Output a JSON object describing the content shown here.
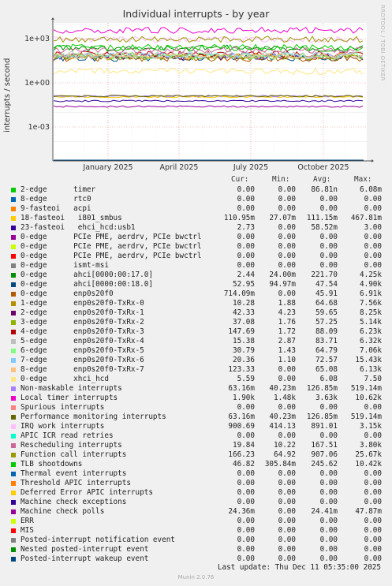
{
  "title": "Individual interrupts - by year",
  "side_text": "RRDTOOL / TOBI OETIKER",
  "ylabel": "interrupts / second",
  "footer": {
    "last_update": "Last update: Thu Dec 11 05:35:00 2025",
    "munin": "Munin 2.0.76"
  },
  "legend_headers": [
    "Cur:",
    "Min:",
    "Avg:",
    "Max:"
  ],
  "chart_data": {
    "type": "line",
    "title": "Individual interrupts - by year",
    "ylabel": "interrupts / second",
    "xlabel": "",
    "y_scale": "log",
    "y_ticks": [
      "1e+03",
      "1e+00",
      "1e-03"
    ],
    "x_ticks": [
      "January 2025",
      "April 2025",
      "July 2025",
      "October 2025"
    ],
    "grid": true,
    "series": [
      {
        "name": "2-edge timer",
        "color": "#00cc00",
        "cur": "0.00",
        "min": "0.00",
        "avg": "86.81n",
        "max": "6.08m"
      },
      {
        "name": "8-edge rtc0",
        "color": "#0066b3",
        "cur": "0.00",
        "min": "0.00",
        "avg": "0.00",
        "max": "0.00"
      },
      {
        "name": "9-fasteoi acpi",
        "color": "#ff8000",
        "cur": "0.00",
        "min": "0.00",
        "avg": "0.00",
        "max": "0.00"
      },
      {
        "name": "18-fasteoi i801_smbus",
        "color": "#ffcc00",
        "cur": "110.95m",
        "min": "27.07m",
        "avg": "111.15m",
        "max": "467.81m"
      },
      {
        "name": "23-fasteoi ehci_hcd:usb1",
        "color": "#330099",
        "cur": "2.73",
        "min": "0.00",
        "avg": "58.52m",
        "max": "3.00"
      },
      {
        "name": "0-edge PCIe PME, aerdrv, PCIe bwctrl",
        "color": "#990099",
        "cur": "0.00",
        "min": "0.00",
        "avg": "0.00",
        "max": "0.00"
      },
      {
        "name": "0-edge PCIe PME, aerdrv, PCIe bwctrl",
        "color": "#ccff00",
        "cur": "0.00",
        "min": "0.00",
        "avg": "0.00",
        "max": "0.00"
      },
      {
        "name": "0-edge PCIe PME, aerdrv, PCIe bwctrl",
        "color": "#ff0000",
        "cur": "0.00",
        "min": "0.00",
        "avg": "0.00",
        "max": "0.00"
      },
      {
        "name": "0-edge ismt-msi",
        "color": "#808080",
        "cur": "0.00",
        "min": "0.00",
        "avg": "0.00",
        "max": "0.00"
      },
      {
        "name": "0-edge ahci[0000:00:17.0]",
        "color": "#008f00",
        "cur": "2.44",
        "min": "24.00m",
        "avg": "221.70",
        "max": "4.25k"
      },
      {
        "name": "0-edge ahci[0000:00:18.0]",
        "color": "#00487d",
        "cur": "52.95",
        "min": "94.97m",
        "avg": "47.54",
        "max": "4.90k"
      },
      {
        "name": "0-edge enp0s20f0",
        "color": "#b35a00",
        "cur": "714.09m",
        "min": "0.00",
        "avg": "45.91",
        "max": "6.91k"
      },
      {
        "name": "1-edge enp0s20f0-TxRx-0",
        "color": "#b38f00",
        "cur": "10.28",
        "min": "1.88",
        "avg": "64.68",
        "max": "7.56k"
      },
      {
        "name": "2-edge enp0s20f0-TxRx-1",
        "color": "#6b006b",
        "cur": "42.33",
        "min": "4.23",
        "avg": "59.65",
        "max": "8.25k"
      },
      {
        "name": "3-edge enp0s20f0-TxRx-2",
        "color": "#8fb300",
        "cur": "37.08",
        "min": "1.76",
        "avg": "57.25",
        "max": "5.14k"
      },
      {
        "name": "4-edge enp0s20f0-TxRx-3",
        "color": "#b30000",
        "cur": "147.69",
        "min": "1.72",
        "avg": "88.09",
        "max": "6.23k"
      },
      {
        "name": "5-edge enp0s20f0-TxRx-4",
        "color": "#bebebe",
        "cur": "15.38",
        "min": "2.87",
        "avg": "83.71",
        "max": "6.32k"
      },
      {
        "name": "6-edge enp0s20f0-TxRx-5",
        "color": "#80ff80",
        "cur": "30.79",
        "min": "1.43",
        "avg": "64.79",
        "max": "7.06k"
      },
      {
        "name": "7-edge enp0s20f0-TxRx-6",
        "color": "#80c9ff",
        "cur": "20.36",
        "min": "1.10",
        "avg": "72.57",
        "max": "15.43k"
      },
      {
        "name": "8-edge enp0s20f0-TxRx-7",
        "color": "#ffc080",
        "cur": "123.33",
        "min": "0.00",
        "avg": "65.08",
        "max": "6.13k"
      },
      {
        "name": "0-edge xhci_hcd",
        "color": "#ffe680",
        "cur": "5.59",
        "min": "0.00",
        "avg": "6.08",
        "max": "7.50"
      },
      {
        "name": "Non-maskable interrupts",
        "color": "#aa80ff",
        "cur": "63.16m",
        "min": "40.23m",
        "avg": "126.85m",
        "max": "519.14m"
      },
      {
        "name": "Local timer interrupts",
        "color": "#ee00cc",
        "cur": "1.90k",
        "min": "1.48k",
        "avg": "3.63k",
        "max": "10.62k"
      },
      {
        "name": "Spurious interrupts",
        "color": "#ff8080",
        "cur": "0.00",
        "min": "0.00",
        "avg": "0.00",
        "max": "0.00"
      },
      {
        "name": "Performance monitoring interrupts",
        "color": "#666600",
        "cur": "63.16m",
        "min": "40.23m",
        "avg": "126.85m",
        "max": "519.14m"
      },
      {
        "name": "IRQ work interrupts",
        "color": "#ffbfff",
        "cur": "900.69",
        "min": "414.13",
        "avg": "891.01",
        "max": "3.15k"
      },
      {
        "name": "APIC ICR read retries",
        "color": "#00ffcc",
        "cur": "0.00",
        "min": "0.00",
        "avg": "0.00",
        "max": "0.00"
      },
      {
        "name": "Rescheduling interrupts",
        "color": "#cc6699",
        "cur": "19.84",
        "min": "10.22",
        "avg": "167.51",
        "max": "3.80k"
      },
      {
        "name": "Function call interrupts",
        "color": "#999900",
        "cur": "166.23",
        "min": "64.92",
        "avg": "907.06",
        "max": "25.67k"
      },
      {
        "name": "TLB shootdowns",
        "color": "#00cc00",
        "cur": "46.82",
        "min": "305.84m",
        "avg": "245.62",
        "max": "10.42k"
      },
      {
        "name": "Thermal event interrupts",
        "color": "#0066b3",
        "cur": "0.00",
        "min": "0.00",
        "avg": "0.00",
        "max": "0.00"
      },
      {
        "name": "Threshold APIC interrupts",
        "color": "#ff8000",
        "cur": "0.00",
        "min": "0.00",
        "avg": "0.00",
        "max": "0.00"
      },
      {
        "name": "Deferred Error APIC interrupts",
        "color": "#ffcc00",
        "cur": "0.00",
        "min": "0.00",
        "avg": "0.00",
        "max": "0.00"
      },
      {
        "name": "Machine check exceptions",
        "color": "#330099",
        "cur": "0.00",
        "min": "0.00",
        "avg": "0.00",
        "max": "0.00"
      },
      {
        "name": "Machine check polls",
        "color": "#990099",
        "cur": "24.36m",
        "min": "0.00",
        "avg": "24.41m",
        "max": "47.87m"
      },
      {
        "name": "ERR",
        "color": "#ccff00",
        "cur": "0.00",
        "min": "0.00",
        "avg": "0.00",
        "max": "0.00"
      },
      {
        "name": "MIS",
        "color": "#ff0000",
        "cur": "0.00",
        "min": "0.00",
        "avg": "0.00",
        "max": "0.00"
      },
      {
        "name": "Posted-interrupt notification event",
        "color": "#808080",
        "cur": "0.00",
        "min": "0.00",
        "avg": "0.00",
        "max": "0.00"
      },
      {
        "name": "Nested posted-interrupt event",
        "color": "#008f00",
        "cur": "0.00",
        "min": "0.00",
        "avg": "0.00",
        "max": "0.00"
      },
      {
        "name": "Posted-interrupt wakeup event",
        "color": "#00487d",
        "cur": "0.00",
        "min": "0.00",
        "avg": "0.00",
        "max": "0.00"
      }
    ]
  },
  "legend_labels": [
    "2-edge      timer",
    "8-edge      rtc0",
    "9-fasteoi   acpi",
    "18-fasteoi   i801_smbus",
    "23-fasteoi   ehci_hcd:usb1",
    "0-edge      PCIe PME, aerdrv, PCIe bwctrl",
    "0-edge      PCIe PME, aerdrv, PCIe bwctrl",
    "0-edge      PCIe PME, aerdrv, PCIe bwctrl",
    "0-edge      ismt-msi",
    "0-edge      ahci[0000:00:17.0]",
    "0-edge      ahci[0000:00:18.0]",
    "0-edge      enp0s20f0",
    "1-edge      enp0s20f0-TxRx-0",
    "2-edge      enp0s20f0-TxRx-1",
    "3-edge      enp0s20f0-TxRx-2",
    "4-edge      enp0s20f0-TxRx-3",
    "5-edge      enp0s20f0-TxRx-4",
    "6-edge      enp0s20f0-TxRx-5",
    "7-edge      enp0s20f0-TxRx-6",
    "8-edge      enp0s20f0-TxRx-7",
    "0-edge      xhci_hcd",
    "Non-maskable interrupts",
    "Local timer interrupts",
    "Spurious interrupts",
    "Performance monitoring interrupts",
    "IRQ work interrupts",
    "APIC ICR read retries",
    "Rescheduling interrupts",
    "Function call interrupts",
    "TLB shootdowns",
    "Thermal event interrupts",
    "Threshold APIC interrupts",
    "Deferred Error APIC interrupts",
    "Machine check exceptions",
    "Machine check polls",
    "ERR",
    "MIS",
    "Posted-interrupt notification event",
    "Nested posted-interrupt event",
    "Posted-interrupt wakeup event"
  ]
}
